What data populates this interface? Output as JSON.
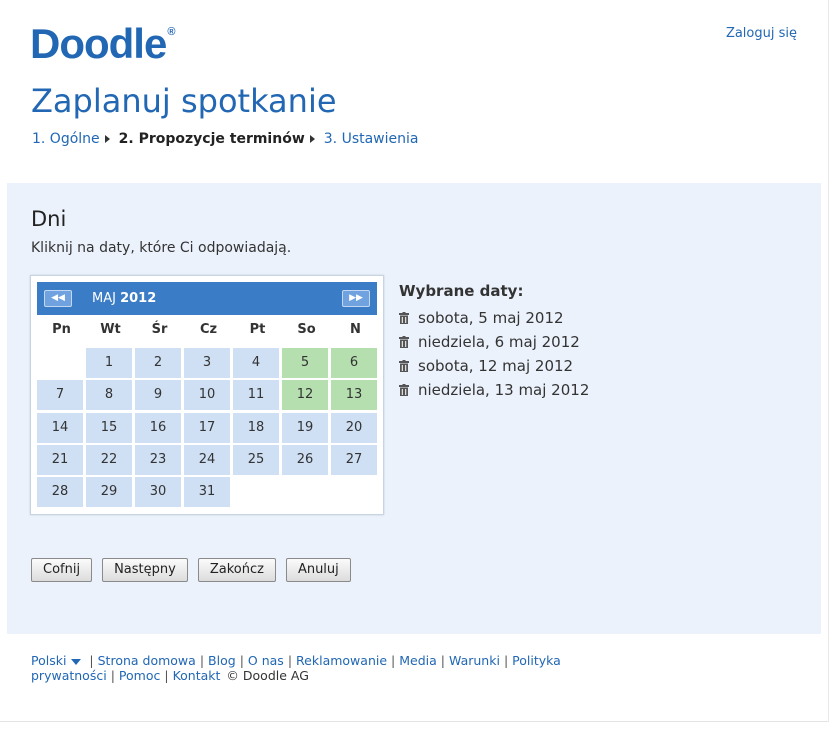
{
  "header": {
    "logo": "Doodle",
    "logo_mark": "®",
    "login": "Zaloguj się"
  },
  "page_title": "Zaplanuj spotkanie",
  "steps": [
    {
      "label": "1. Ogólne",
      "active": false
    },
    {
      "label": "2. Propozycje terminów",
      "active": true
    },
    {
      "label": "3. Ustawienia",
      "active": false
    }
  ],
  "section": {
    "title": "Dni",
    "description": "Kliknij na daty, które Ci odpowiadają."
  },
  "calendar": {
    "month": "MAJ",
    "year": "2012",
    "prev_icon": "double-left-arrow-icon",
    "next_icon": "double-right-arrow-icon",
    "weekdays": [
      "Pn",
      "Wt",
      "Śr",
      "Cz",
      "Pt",
      "So",
      "N"
    ],
    "first_weekday_index": 1,
    "days_in_month": 31,
    "selected_days": [
      5,
      6,
      12,
      13
    ],
    "day_color": "#cfe0f4",
    "selected_color": "#b6dfb0",
    "header_color": "#3a7cc6"
  },
  "chosen": {
    "title": "Wybrane daty:",
    "items": [
      "sobota, 5 maj 2012",
      "niedziela, 6 maj 2012",
      "sobota, 12 maj 2012",
      "niedziela, 13 maj 2012"
    ]
  },
  "buttons": {
    "back": "Cofnij",
    "next": "Następny",
    "finish": "Zakończ",
    "cancel": "Anuluj"
  },
  "footer": {
    "language": "Polski",
    "links": [
      "Strona domowa",
      "Blog",
      "O nas",
      "Reklamowanie",
      "Media",
      "Warunki",
      "Polityka prywatności",
      "Pomoc",
      "Kontakt"
    ],
    "copyright": "© Doodle AG"
  }
}
